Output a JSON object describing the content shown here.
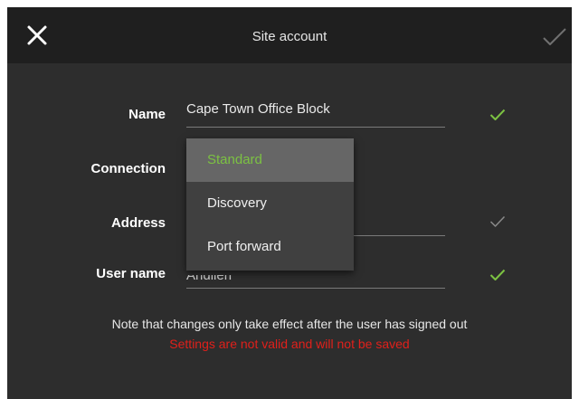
{
  "header": {
    "title": "Site account"
  },
  "form": {
    "name_label": "Name",
    "name_value": "Cape Town Office Block",
    "connection_label": "Connection",
    "address_label": "Address",
    "username_label": "User name",
    "username_value": "Andileri"
  },
  "dropdown": {
    "options": [
      "Standard",
      "Discovery",
      "Port forward"
    ],
    "selected": "Standard"
  },
  "messages": {
    "note": "Note that changes only take effect after the user has signed out",
    "error": "Settings are not valid and will not be saved"
  },
  "colors": {
    "accent_green": "#7cc242",
    "error_red": "#e0201b",
    "check_grey": "#8a8a8a"
  },
  "icons": {
    "close": "close-icon",
    "confirm": "checkmark-icon",
    "valid": "checkmark-icon"
  }
}
